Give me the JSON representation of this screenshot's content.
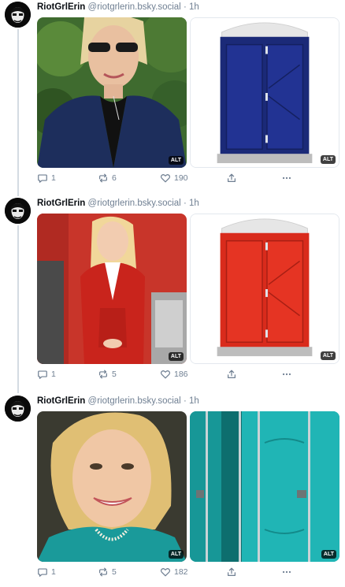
{
  "posts": [
    {
      "author": "RiotGrlErin",
      "handle": "@riotgrlerin.bsky.social",
      "separator": "·",
      "time": "1h",
      "images": [
        {
          "alt_badge": "ALT"
        },
        {
          "alt_badge": "ALT"
        }
      ],
      "counts": {
        "replies": "1",
        "reposts": "6",
        "likes": "190"
      },
      "colors": {
        "toilet": "#1b2a78"
      }
    },
    {
      "author": "RiotGrlErin",
      "handle": "@riotgrlerin.bsky.social",
      "separator": "·",
      "time": "1h",
      "images": [
        {
          "alt_badge": "ALT"
        },
        {
          "alt_badge": "ALT"
        }
      ],
      "counts": {
        "replies": "1",
        "reposts": "5",
        "likes": "186"
      },
      "colors": {
        "toilet": "#d92b1c"
      }
    },
    {
      "author": "RiotGrlErin",
      "handle": "@riotgrlerin.bsky.social",
      "separator": "·",
      "time": "1h",
      "images": [
        {
          "alt_badge": "ALT"
        },
        {
          "alt_badge": "ALT"
        }
      ],
      "counts": {
        "replies": "1",
        "reposts": "5",
        "likes": "182"
      },
      "colors": {
        "toilet": "#1aa8a8"
      }
    }
  ],
  "icons": {
    "reply": "speech-bubble-icon",
    "repost": "repost-arrows-icon",
    "like": "heart-icon",
    "share": "share-icon",
    "more": "more-dots-icon"
  }
}
